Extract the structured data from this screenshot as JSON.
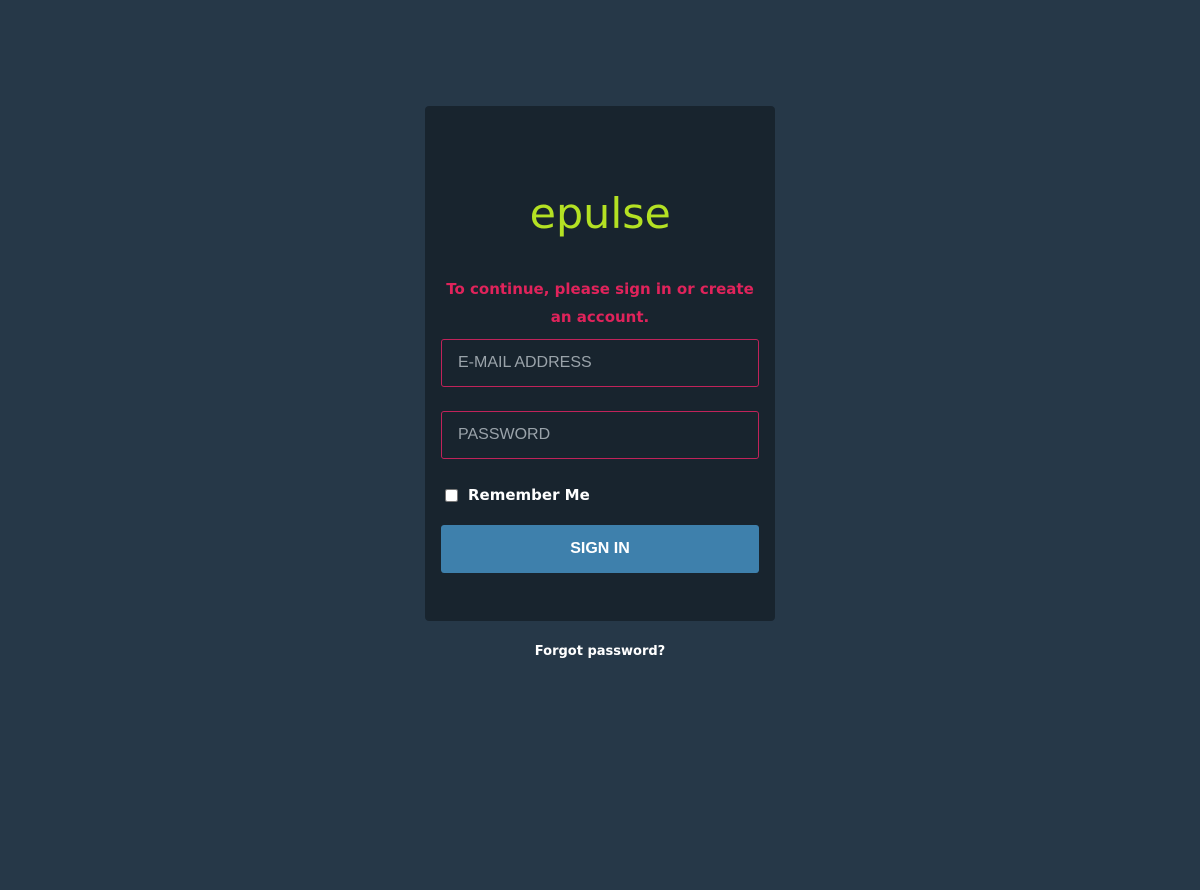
{
  "logo": {
    "text": "epulse",
    "color": "#b4e123"
  },
  "notice": {
    "text": "To continue, please sign in or create an account.",
    "color": "#e0235b"
  },
  "form": {
    "email_placeholder": "E-MAIL ADDRESS",
    "email_value": "",
    "password_placeholder": "PASSWORD",
    "password_value": "",
    "remember_label": "Remember Me",
    "remember_checked": false,
    "signin_label": "SIGN IN"
  },
  "links": {
    "forgot_password": "Forgot password?"
  },
  "colors": {
    "background": "#263848",
    "card": "#18242e",
    "field_border": "#c0235a",
    "button": "#3e80ac"
  }
}
